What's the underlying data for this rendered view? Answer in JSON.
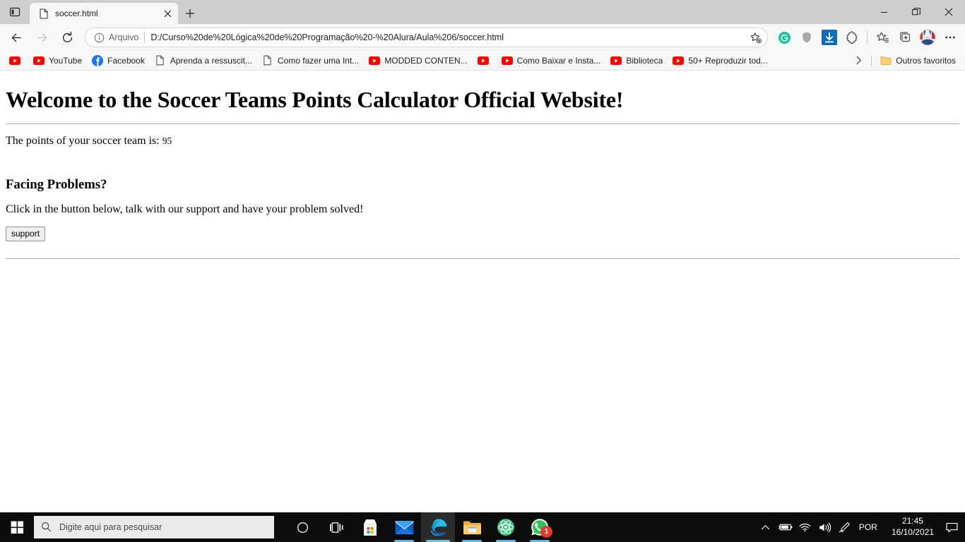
{
  "window": {
    "tab_title": "soccer.html",
    "tab_favicon": "document-icon",
    "minimize_label": "Minimize",
    "restore_label": "Restore",
    "close_label": "Close"
  },
  "nav": {
    "back_label": "Back",
    "forward_label": "Forward",
    "refresh_label": "Refresh"
  },
  "omnibox": {
    "scheme_label": "Arquivo",
    "url": "D:/Curso%20de%20Lógica%20de%20Programação%20-%20Alura/Aula%206/soccer.html",
    "favorite_label": "Add this page to favorites"
  },
  "toolbar": {
    "icons": [
      {
        "name": "grammarly-icon",
        "label": "Grammarly"
      },
      {
        "name": "shield-icon",
        "label": "Shield"
      },
      {
        "name": "download-icon",
        "label": "Downloads"
      },
      {
        "name": "extensions-icon",
        "label": "Extensions"
      },
      {
        "name": "favorites-icon",
        "label": "Favorites"
      },
      {
        "name": "collections-icon",
        "label": "Collections"
      },
      {
        "name": "profile-avatar",
        "label": "Profile"
      },
      {
        "name": "settings-more-icon",
        "label": "Settings and more"
      }
    ]
  },
  "bookmarks": {
    "items": [
      {
        "label": "",
        "icon": "youtube-icon"
      },
      {
        "label": "YouTube",
        "icon": "youtube-icon"
      },
      {
        "label": "Facebook",
        "icon": "facebook-icon"
      },
      {
        "label": "Aprenda a ressuscit...",
        "icon": "document-icon"
      },
      {
        "label": "Como fazer uma Int...",
        "icon": "document-icon"
      },
      {
        "label": "MODDED CONTEN...",
        "icon": "youtube-icon"
      },
      {
        "label": "",
        "icon": "youtube-icon"
      },
      {
        "label": "Como Baixar e Insta...",
        "icon": "youtube-icon"
      },
      {
        "label": "Biblioteca",
        "icon": "youtube-icon"
      },
      {
        "label": "50+ Reproduzir tod...",
        "icon": "youtube-icon"
      }
    ],
    "overflow_label": "More bookmarks",
    "other_favorites": "Outros favoritos",
    "other_favorites_icon": "folder-icon"
  },
  "page": {
    "heading": "Welcome to the Soccer Teams Points Calculator Official Website!",
    "points_label": "The points of your soccer team is:",
    "points_value": "95",
    "problems_heading": "Facing Problems?",
    "problems_text": "Click in the button below, talk with our support and have your problem solved!",
    "support_button": "support"
  },
  "taskbar": {
    "start_label": "Start",
    "search_placeholder": "Digite aqui para pesquisar",
    "search_icon": "search-icon",
    "apps": [
      {
        "name": "cortana-icon",
        "label": "Cortana",
        "running": false,
        "active": false,
        "badge": ""
      },
      {
        "name": "task-view-icon",
        "label": "Task View",
        "running": false,
        "active": false,
        "badge": ""
      },
      {
        "name": "microsoft-store-icon",
        "label": "Microsoft Store",
        "running": false,
        "active": false,
        "badge": ""
      },
      {
        "name": "mail-icon",
        "label": "Mail",
        "running": true,
        "active": false,
        "badge": ""
      },
      {
        "name": "microsoft-edge-icon",
        "label": "Microsoft Edge",
        "running": true,
        "active": true,
        "badge": ""
      },
      {
        "name": "file-explorer-icon",
        "label": "File Explorer",
        "running": true,
        "active": false,
        "badge": ""
      },
      {
        "name": "atom-icon",
        "label": "Atom",
        "running": true,
        "active": false,
        "badge": ""
      },
      {
        "name": "whatsapp-icon",
        "label": "WhatsApp",
        "running": true,
        "active": false,
        "badge": "1"
      }
    ],
    "tray": {
      "chevron_label": "Show hidden icons",
      "battery_label": "Battery charging",
      "wifi_label": "Network",
      "volume_label": "Volume",
      "pen_label": "Windows Ink Workspace",
      "language": "POR",
      "time": "21:45",
      "date": "16/10/2021",
      "notifications_label": "Notifications"
    }
  },
  "colors": {
    "accent": "#0078d7",
    "youtube_red": "#ff0000",
    "facebook_blue": "#1877f2",
    "taskbar_bg": "#0c0c0c",
    "chrome_bg": "#f7f7f7",
    "badge_red": "#e23b2e"
  }
}
